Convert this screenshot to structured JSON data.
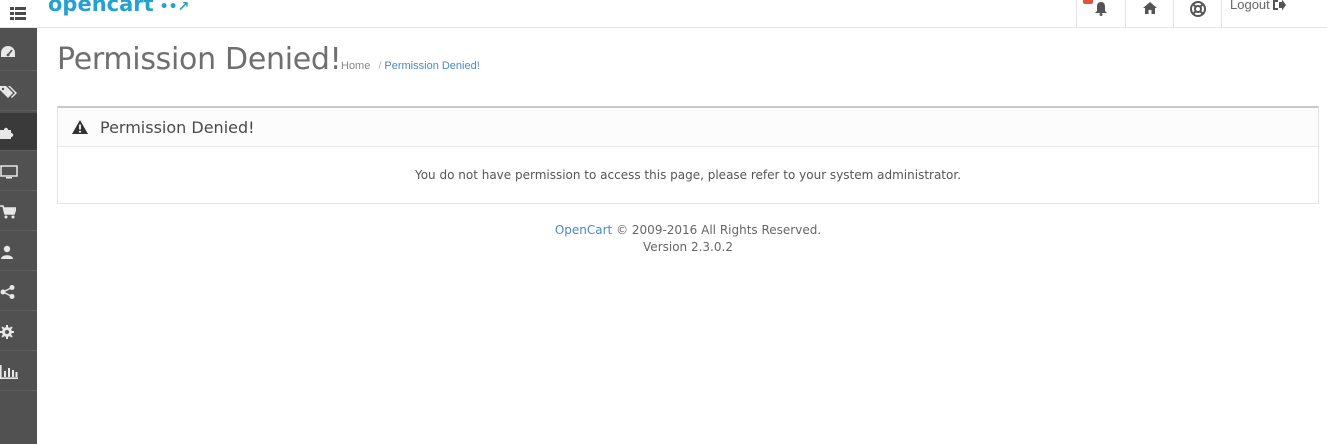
{
  "header": {
    "logo_text": "opencart",
    "nav": {
      "logout_label": "Logout"
    }
  },
  "sidebar": {
    "items": [
      {
        "icon": "dashboard-icon"
      },
      {
        "icon": "tags-icon"
      },
      {
        "icon": "puzzle-icon",
        "active": true
      },
      {
        "icon": "desktop-icon"
      },
      {
        "icon": "shopping-cart-icon"
      },
      {
        "icon": "user-icon"
      },
      {
        "icon": "share-icon"
      },
      {
        "icon": "gear-icon"
      },
      {
        "icon": "bar-chart-icon"
      }
    ]
  },
  "page": {
    "title": "Permission Denied!",
    "breadcrumb": {
      "home": "Home",
      "separator": "/",
      "current": "Permission Denied!"
    }
  },
  "panel": {
    "title": "Permission Denied!",
    "message": "You do not have permission to access this page, please refer to your system administrator."
  },
  "footer": {
    "brand": "OpenCart",
    "copyright": "© 2009-2016 All Rights Reserved.",
    "version": "Version 2.3.0.2"
  },
  "colors": {
    "accent": "#23a1d1",
    "link": "#4a8ac2",
    "sidebar_bg": "#515151",
    "badge": "#e3503e"
  }
}
